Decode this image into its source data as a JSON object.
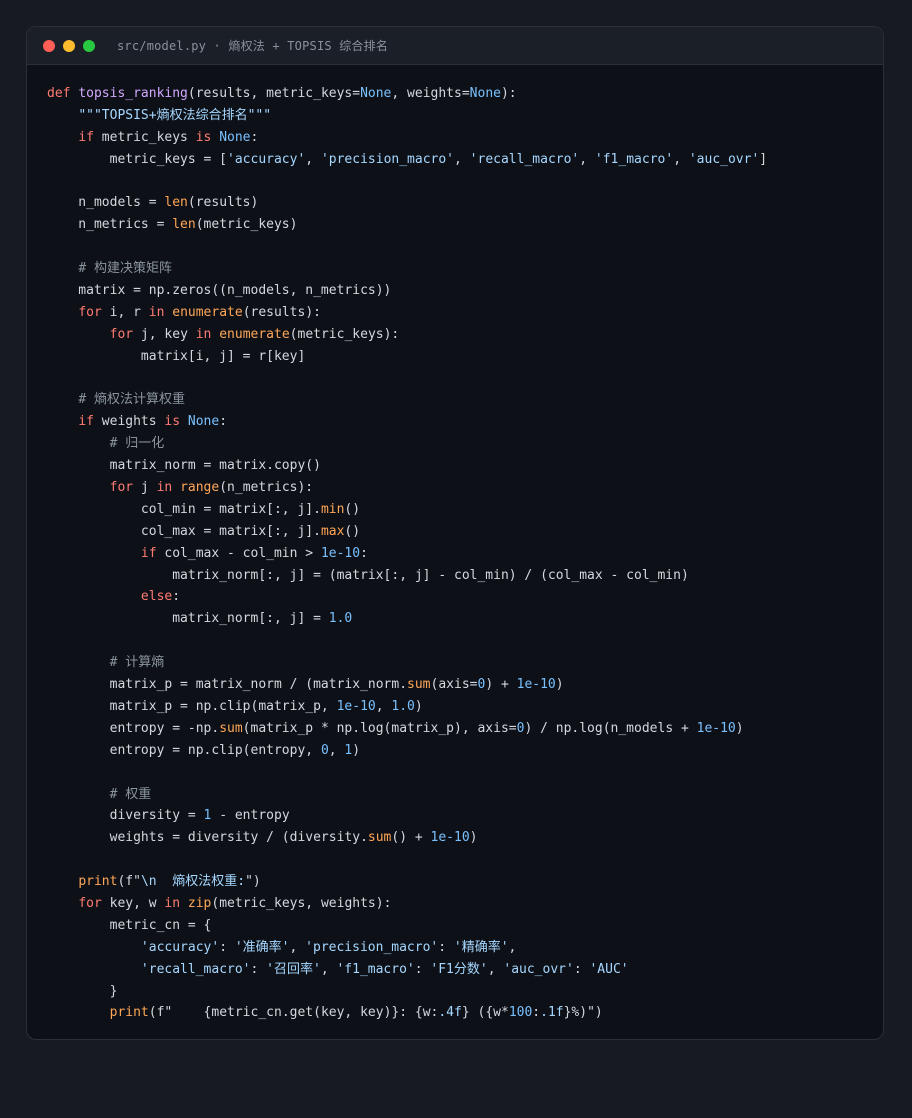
{
  "window": {
    "title": "src/model.py · 熵权法 + TOPSIS 综合排名",
    "colors": {
      "close": "#ff5f57",
      "minimize": "#febc2e",
      "maximize": "#28c840"
    }
  },
  "code": {
    "language": "python",
    "lines": [
      [
        [
          "def",
          "kw"
        ],
        [
          " ",
          ""
        ],
        [
          "topsis_ranking",
          "fn"
        ],
        [
          "(results, metric_keys=",
          ""
        ],
        [
          "None",
          "cst"
        ],
        [
          ", weights=",
          ""
        ],
        [
          "None",
          "cst"
        ],
        [
          "):",
          ""
        ]
      ],
      [
        [
          "    ",
          ""
        ],
        [
          "\"\"\"TOPSIS+熵权法综合排名\"\"\"",
          "str"
        ]
      ],
      [
        [
          "    ",
          ""
        ],
        [
          "if",
          "kw"
        ],
        [
          " metric_keys ",
          ""
        ],
        [
          "is",
          "kw"
        ],
        [
          " ",
          ""
        ],
        [
          "None",
          "cst"
        ],
        [
          ":",
          ""
        ]
      ],
      [
        [
          "        metric_keys = [",
          ""
        ],
        [
          "'accuracy'",
          "str"
        ],
        [
          ", ",
          ""
        ],
        [
          "'precision_macro'",
          "str"
        ],
        [
          ", ",
          ""
        ],
        [
          "'recall_macro'",
          "str"
        ],
        [
          ", ",
          ""
        ],
        [
          "'f1_macro'",
          "str"
        ],
        [
          ", ",
          ""
        ],
        [
          "'auc_ovr'",
          "str"
        ],
        [
          "]",
          ""
        ]
      ],
      [],
      [
        [
          "    n_models = ",
          ""
        ],
        [
          "len",
          "bi"
        ],
        [
          "(results)",
          ""
        ]
      ],
      [
        [
          "    n_metrics = ",
          ""
        ],
        [
          "len",
          "bi"
        ],
        [
          "(metric_keys)",
          ""
        ]
      ],
      [],
      [
        [
          "    ",
          ""
        ],
        [
          "# 构建决策矩阵",
          "cm"
        ]
      ],
      [
        [
          "    matrix = np.zeros((n_models, n_metrics))",
          ""
        ]
      ],
      [
        [
          "    ",
          ""
        ],
        [
          "for",
          "kw"
        ],
        [
          " i, r ",
          ""
        ],
        [
          "in",
          "kw"
        ],
        [
          " ",
          ""
        ],
        [
          "enumerate",
          "bi"
        ],
        [
          "(results):",
          ""
        ]
      ],
      [
        [
          "        ",
          ""
        ],
        [
          "for",
          "kw"
        ],
        [
          " j, key ",
          ""
        ],
        [
          "in",
          "kw"
        ],
        [
          " ",
          ""
        ],
        [
          "enumerate",
          "bi"
        ],
        [
          "(metric_keys):",
          ""
        ]
      ],
      [
        [
          "            matrix[i, j] = r[key]",
          ""
        ]
      ],
      [],
      [
        [
          "    ",
          ""
        ],
        [
          "# 熵权法计算权重",
          "cm"
        ]
      ],
      [
        [
          "    ",
          ""
        ],
        [
          "if",
          "kw"
        ],
        [
          " weights ",
          ""
        ],
        [
          "is",
          "kw"
        ],
        [
          " ",
          ""
        ],
        [
          "None",
          "cst"
        ],
        [
          ":",
          ""
        ]
      ],
      [
        [
          "        ",
          ""
        ],
        [
          "# 归一化",
          "cm"
        ]
      ],
      [
        [
          "        matrix_norm = matrix.copy()",
          ""
        ]
      ],
      [
        [
          "        ",
          ""
        ],
        [
          "for",
          "kw"
        ],
        [
          " j ",
          ""
        ],
        [
          "in",
          "kw"
        ],
        [
          " ",
          ""
        ],
        [
          "range",
          "bi"
        ],
        [
          "(n_metrics):",
          ""
        ]
      ],
      [
        [
          "            col_min = matrix[:, j].",
          ""
        ],
        [
          "min",
          "bi"
        ],
        [
          "()",
          ""
        ]
      ],
      [
        [
          "            col_max = matrix[:, j].",
          ""
        ],
        [
          "max",
          "bi"
        ],
        [
          "()",
          ""
        ]
      ],
      [
        [
          "            ",
          ""
        ],
        [
          "if",
          "kw"
        ],
        [
          " col_max - col_min > ",
          ""
        ],
        [
          "1e-10",
          "num"
        ],
        [
          ":",
          ""
        ]
      ],
      [
        [
          "                matrix_norm[:, j] = (matrix[:, j] - col_min) / (col_max - col_min)",
          ""
        ]
      ],
      [
        [
          "            ",
          ""
        ],
        [
          "else",
          "kw"
        ],
        [
          ":",
          ""
        ]
      ],
      [
        [
          "                matrix_norm[:, j] = ",
          ""
        ],
        [
          "1.0",
          "num"
        ]
      ],
      [],
      [
        [
          "        ",
          ""
        ],
        [
          "# 计算熵",
          "cm"
        ]
      ],
      [
        [
          "        matrix_p = matrix_norm / (matrix_norm.",
          ""
        ],
        [
          "sum",
          "bi"
        ],
        [
          "(axis=",
          ""
        ],
        [
          "0",
          "num"
        ],
        [
          ") + ",
          ""
        ],
        [
          "1e-10",
          "num"
        ],
        [
          ")",
          ""
        ]
      ],
      [
        [
          "        matrix_p = np.clip(matrix_p, ",
          ""
        ],
        [
          "1e-10",
          "num"
        ],
        [
          ", ",
          ""
        ],
        [
          "1.0",
          "num"
        ],
        [
          ")",
          ""
        ]
      ],
      [
        [
          "        entropy = -np.",
          ""
        ],
        [
          "sum",
          "bi"
        ],
        [
          "(matrix_p * np.log(matrix_p), axis=",
          ""
        ],
        [
          "0",
          "num"
        ],
        [
          ") / np.log(n_models + ",
          ""
        ],
        [
          "1e-10",
          "num"
        ],
        [
          ")",
          ""
        ]
      ],
      [
        [
          "        entropy = np.clip(entropy, ",
          ""
        ],
        [
          "0",
          "num"
        ],
        [
          ", ",
          ""
        ],
        [
          "1",
          "num"
        ],
        [
          ")",
          ""
        ]
      ],
      [],
      [
        [
          "        ",
          ""
        ],
        [
          "# 权重",
          "cm"
        ]
      ],
      [
        [
          "        diversity = ",
          ""
        ],
        [
          "1",
          "num"
        ],
        [
          " - entropy",
          ""
        ]
      ],
      [
        [
          "        weights = diversity / (diversity.",
          ""
        ],
        [
          "sum",
          "bi"
        ],
        [
          "() + ",
          ""
        ],
        [
          "1e-10",
          "num"
        ],
        [
          ")",
          ""
        ]
      ],
      [],
      [
        [
          "    ",
          ""
        ],
        [
          "print",
          "bi"
        ],
        [
          "(f\"",
          ""
        ],
        [
          "\\n  熵权法权重:",
          "str"
        ],
        [
          "\")",
          ""
        ]
      ],
      [
        [
          "    ",
          ""
        ],
        [
          "for",
          "kw"
        ],
        [
          " key, w ",
          ""
        ],
        [
          "in",
          "kw"
        ],
        [
          " ",
          ""
        ],
        [
          "zip",
          "bi"
        ],
        [
          "(metric_keys, weights):",
          ""
        ]
      ],
      [
        [
          "        metric_cn = {",
          ""
        ]
      ],
      [
        [
          "            ",
          ""
        ],
        [
          "'accuracy'",
          "str"
        ],
        [
          ": ",
          ""
        ],
        [
          "'准确率'",
          "str"
        ],
        [
          ", ",
          ""
        ],
        [
          "'precision_macro'",
          "str"
        ],
        [
          ": ",
          ""
        ],
        [
          "'精确率'",
          "str"
        ],
        [
          ",",
          ""
        ]
      ],
      [
        [
          "            ",
          ""
        ],
        [
          "'recall_macro'",
          "str"
        ],
        [
          ": ",
          ""
        ],
        [
          "'召回率'",
          "str"
        ],
        [
          ", ",
          ""
        ],
        [
          "'f1_macro'",
          "str"
        ],
        [
          ": ",
          ""
        ],
        [
          "'F1分数'",
          "str"
        ],
        [
          ", ",
          ""
        ],
        [
          "'auc_ovr'",
          "str"
        ],
        [
          ": ",
          ""
        ],
        [
          "'AUC'",
          "str"
        ]
      ],
      [
        [
          "        }",
          ""
        ]
      ],
      [
        [
          "        ",
          ""
        ],
        [
          "print",
          "bi"
        ],
        [
          "(f\"    {metric_cn.get(key, key)}: {w:",
          ""
        ],
        [
          ".4f",
          "str"
        ],
        [
          "} ({w*",
          ""
        ],
        [
          "100",
          "num"
        ],
        [
          ":",
          ""
        ],
        [
          ".1f",
          "str"
        ],
        [
          "}%)\")",
          ""
        ]
      ]
    ]
  }
}
